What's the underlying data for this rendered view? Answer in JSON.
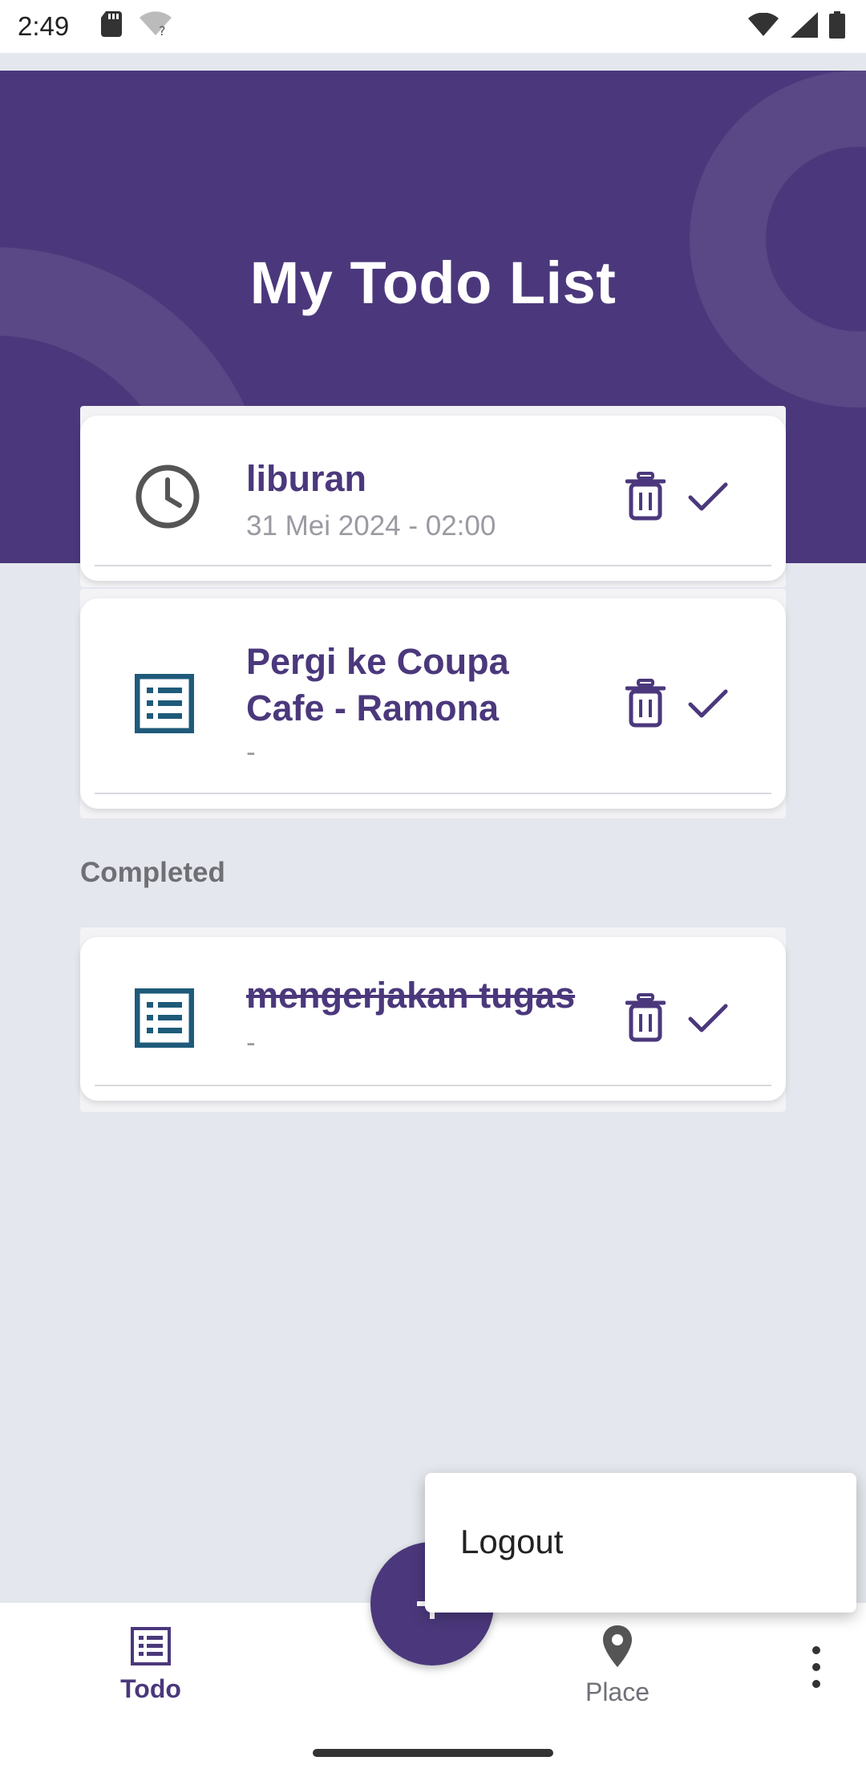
{
  "status_bar": {
    "time": "2:49"
  },
  "header": {
    "title": "My Todo List"
  },
  "todos": [
    {
      "title": "liburan",
      "subtitle": "31 Mei 2024 - 02:00"
    },
    {
      "title": "Pergi ke Coupa Cafe - Ramona",
      "subtitle": "-"
    }
  ],
  "completed": {
    "label": "Completed",
    "items": [
      {
        "title": "mengerjakan tugas",
        "subtitle": "-"
      }
    ]
  },
  "bottom_nav": {
    "todo_label": "Todo",
    "place_label": "Place"
  },
  "menu": {
    "logout_label": "Logout"
  },
  "colors": {
    "primary": "#4b387c",
    "icon_blue": "#1f5a7a",
    "background": "#e4e7ed"
  }
}
